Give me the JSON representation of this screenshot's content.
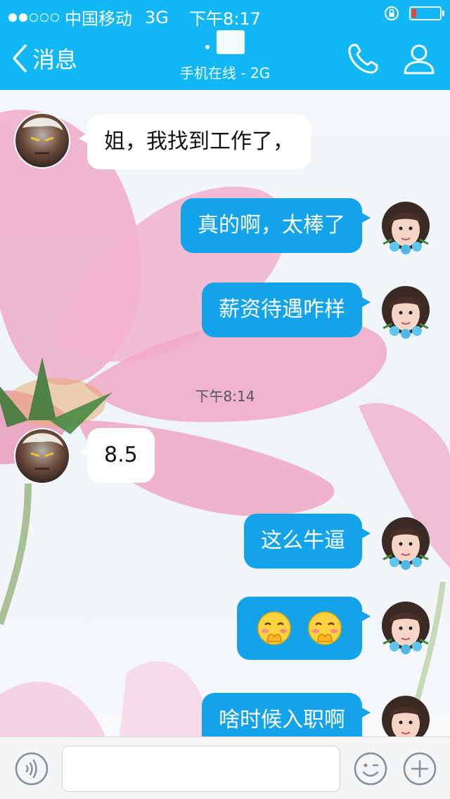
{
  "status_bar": {
    "carrier": "中国移动",
    "network": "3G",
    "time": "下午8:17",
    "signal_bars_filled": 2,
    "signal_bars_total": 5,
    "battery_level": 0.15,
    "battery_color": "#ff3b30"
  },
  "nav": {
    "back_label": "消息",
    "contact_status": "手机在线 - 2G",
    "accent_color": "#12b7f5",
    "icons": [
      "chevron-left-icon",
      "phone-icon",
      "profile-icon"
    ]
  },
  "messages": [
    {
      "side": "in",
      "text": "姐，我找到工作了，"
    },
    {
      "side": "out",
      "text": "真的啊，太棒了"
    },
    {
      "side": "out",
      "text": "薪资待遇咋样"
    },
    {
      "timestamp": "下午8:14"
    },
    {
      "side": "in",
      "text": "8.5"
    },
    {
      "side": "out",
      "text": "这么牛逼"
    },
    {
      "side": "out",
      "emoji": [
        "shy-face-emoji",
        "shy-face-emoji"
      ]
    },
    {
      "side": "out",
      "text": "啥时候入职啊"
    }
  ],
  "input_bar": {
    "placeholder": "",
    "icons": [
      "voice-icon",
      "emoji-icon",
      "plus-icon"
    ]
  },
  "colors": {
    "incoming_bubble": "#ffffff",
    "outgoing_bubble": "#12a3ea"
  }
}
